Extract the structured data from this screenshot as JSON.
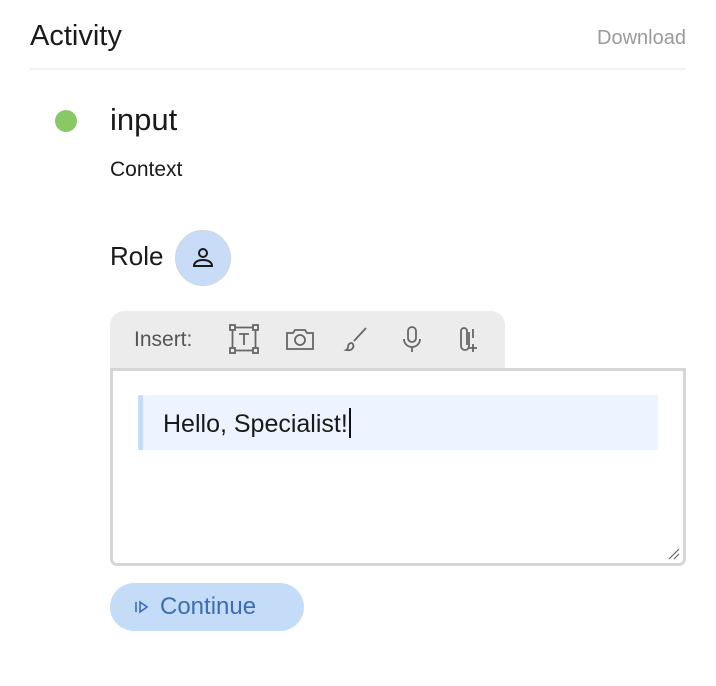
{
  "header": {
    "title": "Activity",
    "download_label": "Download"
  },
  "step": {
    "name": "input",
    "status_color": "#88c966",
    "context_label": "Context",
    "role_label": "Role",
    "role_icon": "person-icon"
  },
  "toolbar": {
    "insert_label": "Insert:",
    "tools": [
      "text-box-icon",
      "camera-icon",
      "brush-icon",
      "microphone-icon",
      "attach-file-icon"
    ]
  },
  "editor": {
    "value": "Hello, Specialist!"
  },
  "actions": {
    "continue_label": "Continue",
    "continue_icon": "play-step-icon"
  },
  "colors": {
    "accent_bg": "#c5dcf8",
    "accent_text": "#3b6db5",
    "highlight_bg": "#edf4ff"
  }
}
